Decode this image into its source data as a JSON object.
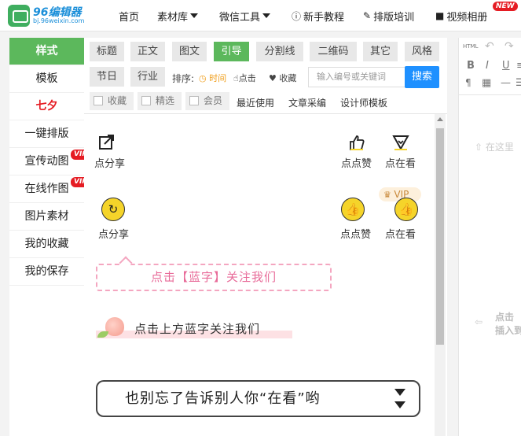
{
  "logo": {
    "name": "96编辑器",
    "url": "bj.96weixin.com"
  },
  "nav": {
    "home": "首页",
    "materials": "素材库",
    "wechat_tools": "微信工具",
    "tutorial": "新手教程",
    "training": "排版培训",
    "video_album": "视频相册",
    "new_badge": "NEW"
  },
  "sidebar": {
    "items": [
      {
        "label": "样式"
      },
      {
        "label": "模板"
      },
      {
        "label": "七夕"
      },
      {
        "label": "一键排版"
      },
      {
        "label": "宣传动图",
        "badge": "VIP"
      },
      {
        "label": "在线作图",
        "badge": "VIP"
      },
      {
        "label": "图片素材"
      },
      {
        "label": "我的收藏"
      },
      {
        "label": "我的保存"
      }
    ]
  },
  "tabs": {
    "row1": [
      "标题",
      "正文",
      "图文",
      "引导",
      "分割线",
      "二维码",
      "其它",
      "风格"
    ],
    "row2": [
      "节日",
      "行业"
    ],
    "active": "引导"
  },
  "sort": {
    "label": "排序:",
    "time": "时间",
    "clicks": "点击",
    "favorites": "收藏"
  },
  "search": {
    "placeholder": "输入编号或关键词",
    "button": "搜索"
  },
  "filters": [
    "收藏",
    "精选",
    "会员"
  ],
  "links": [
    "最近使用",
    "文章采编",
    "设计师模板"
  ],
  "content": {
    "share1": "点分享",
    "like1": "点点赞",
    "watch1": "点在看",
    "share2": "点分享",
    "like2": "点点赞",
    "watch2": "点在看",
    "vip": "VIP",
    "follow_blue": "点击【蓝字】关注我们",
    "follow_above": "点击上方蓝字关注我们",
    "tell_others": "也别忘了告诉别人你“在看”哟"
  },
  "editor": {
    "html_label": "HTML",
    "placeholder1": "在这里",
    "placeholder2a": "点击",
    "placeholder2b": "插入到"
  },
  "colors": {
    "green": "#5cb85c",
    "blue": "#1e90ff",
    "red": "#e51c23",
    "pink": "#e86b99"
  }
}
